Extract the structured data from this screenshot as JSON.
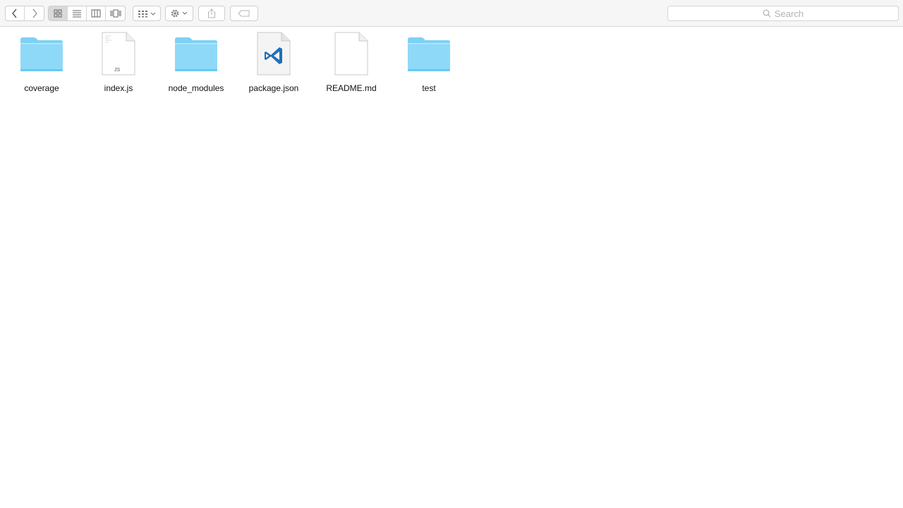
{
  "toolbar": {
    "nav": [
      {
        "name": "back-button",
        "icon": "chevron-left-icon"
      },
      {
        "name": "forward-button",
        "icon": "chevron-right-icon"
      }
    ],
    "view_modes": [
      {
        "name": "icon-view-button",
        "icon": "grid-icon",
        "active": true
      },
      {
        "name": "list-view-button",
        "icon": "list-icon",
        "active": false
      },
      {
        "name": "column-view-button",
        "icon": "columns-icon",
        "active": false
      },
      {
        "name": "coverflow-view-button",
        "icon": "coverflow-icon",
        "active": false
      }
    ],
    "arrange_icon": "arrange-grid-icon",
    "action_icon": "gear-icon",
    "share_icon": "share-icon",
    "tags_icon": "tag-icon"
  },
  "search": {
    "placeholder": "Search",
    "icon": "search-icon"
  },
  "files": [
    {
      "label": "coverage",
      "kind": "folder",
      "icon": "folder-icon"
    },
    {
      "label": "index.js",
      "kind": "js-file",
      "icon": "js-file-icon",
      "badge": "JS"
    },
    {
      "label": "node_modules",
      "kind": "folder",
      "icon": "folder-icon"
    },
    {
      "label": "package.json",
      "kind": "vscode-file",
      "icon": "vscode-file-icon"
    },
    {
      "label": "README.md",
      "kind": "blank-file",
      "icon": "document-icon"
    },
    {
      "label": "test",
      "kind": "folder",
      "icon": "folder-icon"
    }
  ],
  "colors": {
    "folder_light": "#8fd9f8",
    "folder_dark": "#5ec6f2",
    "vscode_blue": "#1f6fb8"
  }
}
